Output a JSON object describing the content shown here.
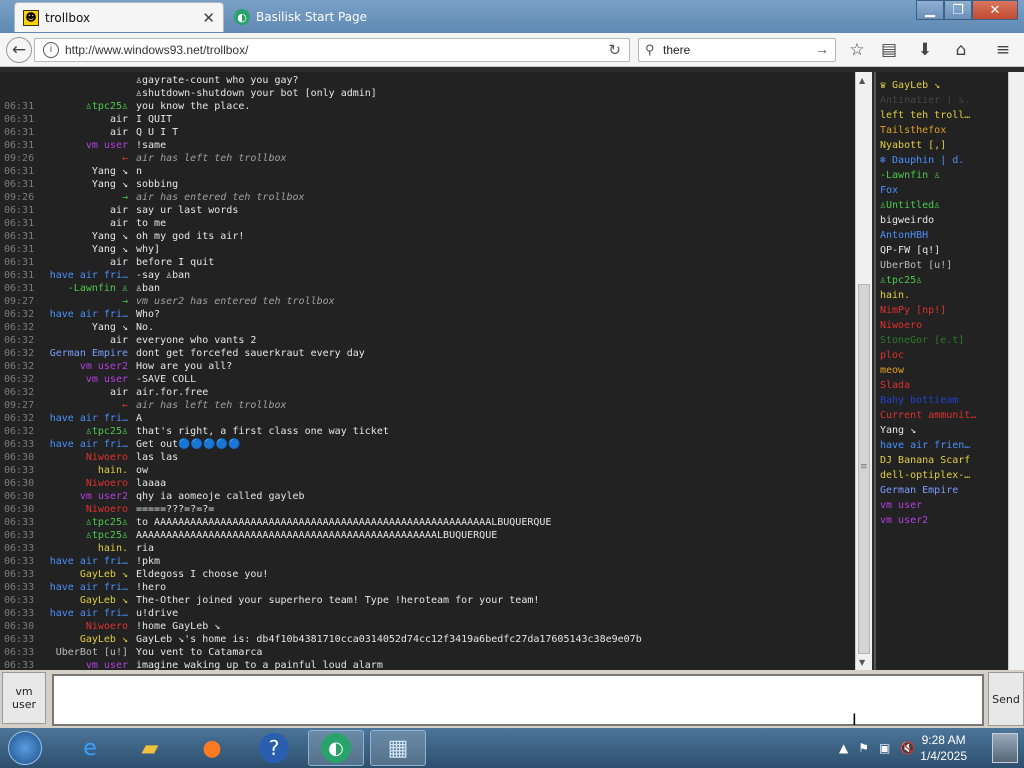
{
  "browser": {
    "tabs": [
      {
        "title": "trollbox",
        "active": true
      },
      {
        "title": "Basilisk Start Page",
        "active": false
      }
    ],
    "url": "http://www.windows93.net/trollbox/",
    "search_value": "there"
  },
  "chat": {
    "messages": [
      {
        "time": "",
        "nick": "",
        "nick_color": "#aaaaaa",
        "text": "♙gayrate-count who you gay?",
        "system": false
      },
      {
        "time": "",
        "nick": "",
        "nick_color": "#aaaaaa",
        "text": "♙shutdown-shutdown your bot [only admin]",
        "system": false
      },
      {
        "time": "06:31",
        "nick": "♙tpc25♙",
        "nick_color": "#4ec94e",
        "text": "you know the place.",
        "system": false
      },
      {
        "time": "06:31",
        "nick": "air",
        "nick_color": "#e6e6e6",
        "text": "I QUIT",
        "system": false
      },
      {
        "time": "06:31",
        "nick": "air",
        "nick_color": "#e6e6e6",
        "text": "Q U I T",
        "system": false
      },
      {
        "time": "06:31",
        "nick": "vm user",
        "nick_color": "#b040e0",
        "text": "!same",
        "system": false
      },
      {
        "time": "09:26",
        "nick": "←",
        "nick_color": "#e03030",
        "text": "air has left teh trollbox",
        "system": true
      },
      {
        "time": "06:31",
        "nick": "Yang ↘",
        "nick_color": "#e6e6e6",
        "text": "n",
        "system": false
      },
      {
        "time": "06:31",
        "nick": "Yang ↘",
        "nick_color": "#e6e6e6",
        "text": " sobbing",
        "system": false
      },
      {
        "time": "09:26",
        "nick": "→",
        "nick_color": "#4ec94e",
        "text": "air has entered teh trollbox",
        "system": true
      },
      {
        "time": "06:31",
        "nick": "air",
        "nick_color": "#e6e6e6",
        "text": "say ur last words",
        "system": false
      },
      {
        "time": "06:31",
        "nick": "air",
        "nick_color": "#e6e6e6",
        "text": "to me",
        "system": false
      },
      {
        "time": "06:31",
        "nick": "Yang ↘",
        "nick_color": "#e6e6e6",
        "text": "oh my god its air!",
        "system": false
      },
      {
        "time": "06:31",
        "nick": "Yang ↘",
        "nick_color": "#e6e6e6",
        "text": "why]",
        "system": false
      },
      {
        "time": "06:31",
        "nick": "air",
        "nick_color": "#e6e6e6",
        "text": "before I quit",
        "system": false
      },
      {
        "time": "06:31",
        "nick": "have air fri…",
        "nick_color": "#4a90ff",
        "text": "-say ♙ban",
        "system": false
      },
      {
        "time": "06:31",
        "nick": "-Lawnfin ♙",
        "nick_color": "#4ec94e",
        "text": "♙ban",
        "system": false
      },
      {
        "time": "09:27",
        "nick": "→",
        "nick_color": "#4ec94e",
        "text": "vm user2 has entered teh trollbox",
        "system": true
      },
      {
        "time": "06:32",
        "nick": "have air fri…",
        "nick_color": "#4a90ff",
        "text": "Who?",
        "system": false
      },
      {
        "time": "06:32",
        "nick": "Yang ↘",
        "nick_color": "#e6e6e6",
        "text": "No.",
        "system": false
      },
      {
        "time": "06:32",
        "nick": "air",
        "nick_color": "#e6e6e6",
        "text": "everyone who vants 2",
        "system": false
      },
      {
        "time": "06:32",
        "nick": "German Empire",
        "nick_color": "#7a9cff",
        "text": "dont get forcefed sauerkraut every day",
        "system": false
      },
      {
        "time": "06:32",
        "nick": "vm user2",
        "nick_color": "#b040e0",
        "text": "How are you all?",
        "system": false
      },
      {
        "time": "06:32",
        "nick": "vm user",
        "nick_color": "#b040e0",
        "text": "-SAVE COLL",
        "system": false
      },
      {
        "time": "06:32",
        "nick": "air",
        "nick_color": "#e6e6e6",
        "text": "air.for.free",
        "system": false
      },
      {
        "time": "09:27",
        "nick": "←",
        "nick_color": "#e03030",
        "text": "air has left teh trollbox",
        "system": true
      },
      {
        "time": "06:32",
        "nick": "have air fri…",
        "nick_color": "#4a90ff",
        "text": "A",
        "system": false
      },
      {
        "time": "06:32",
        "nick": "♙tpc25♙",
        "nick_color": "#4ec94e",
        "text": "that's right, a first class one way ticket",
        "system": false
      },
      {
        "time": "06:33",
        "nick": "have air fri…",
        "nick_color": "#4a90ff",
        "text": "Get out🔵🔵🔵🔵🔵",
        "system": false
      },
      {
        "time": "06:30",
        "nick": "Niwoero",
        "nick_color": "#e03030",
        "text": "las las",
        "system": false
      },
      {
        "time": "06:33",
        "nick": "hain.",
        "nick_color": "#e0d040",
        "text": "ow",
        "system": false
      },
      {
        "time": "06:30",
        "nick": "Niwoero",
        "nick_color": "#e03030",
        "text": "laaaa",
        "system": false
      },
      {
        "time": "06:30",
        "nick": "vm user2",
        "nick_color": "#b040e0",
        "text": "qhy ia aomeoje called gayleb",
        "system": false
      },
      {
        "time": "06:30",
        "nick": "Niwoero",
        "nick_color": "#e03030",
        "text": "=====???=?=?=",
        "system": false
      },
      {
        "time": "06:33",
        "nick": "♙tpc25♙",
        "nick_color": "#4ec94e",
        "text": "to AAAAAAAAAAAAAAAAAAAAAAAAAAAAAAAAAAAAAAAAAAAAAAAAAAAAAAAALBUQUERQUE",
        "system": false
      },
      {
        "time": "06:33",
        "nick": "♙tpc25♙",
        "nick_color": "#4ec94e",
        "text": "AAAAAAAAAAAAAAAAAAAAAAAAAAAAAAAAAAAAAAAAAAAAAAAAAALBUQUERQUE",
        "system": false
      },
      {
        "time": "06:33",
        "nick": "hain.",
        "nick_color": "#e0d040",
        "text": "ria",
        "system": false
      },
      {
        "time": "06:33",
        "nick": "have air fri…",
        "nick_color": "#4a90ff",
        "text": "!pkm",
        "system": false
      },
      {
        "time": "06:33",
        "nick": "GayLeb ↘",
        "nick_color": "#e0d040",
        "text": "Eldegoss I choose you!",
        "system": false
      },
      {
        "time": "06:33",
        "nick": "have air fri…",
        "nick_color": "#4a90ff",
        "text": "!hero",
        "system": false
      },
      {
        "time": "06:33",
        "nick": "GayLeb ↘",
        "nick_color": "#e0d040",
        "text": "The-Other joined your superhero team! Type !heroteam for your team!",
        "system": false
      },
      {
        "time": "06:33",
        "nick": "have air fri…",
        "nick_color": "#4a90ff",
        "text": "u!drive",
        "system": false
      },
      {
        "time": "06:30",
        "nick": "Niwoero",
        "nick_color": "#e03030",
        "text": "!home GayLeb ↘",
        "system": false
      },
      {
        "time": "06:33",
        "nick": "GayLeb ↘",
        "nick_color": "#e0d040",
        "text": "GayLeb ↘'s home is: db4f10b4381710cca0314052d74cc12f3419a6bedfc27da17605143c38e9e07b",
        "system": false
      },
      {
        "time": "06:33",
        "nick": "UberBot [u!]",
        "nick_color": "#bbbbbb",
        "text": "You vent to Catamarca",
        "system": false
      },
      {
        "time": "06:33",
        "nick": "vm user",
        "nick_color": "#b040e0",
        "text": "imagine waking up to a painful loud alarm",
        "system": false
      }
    ]
  },
  "users": [
    {
      "name": "♛ GayLeb ↘",
      "color": "#e0d040"
    },
    {
      "name": "Antinatier | s.",
      "color": "#444444"
    },
    {
      "name": "left teh troll…",
      "color": "#e0d040"
    },
    {
      "name": "Tailsthefox",
      "color": "#e0a020"
    },
    {
      "name": "Nyabott [,]",
      "color": "#e0d040"
    },
    {
      "name": "❄ Dauphin | d.",
      "color": "#4a90ff"
    },
    {
      "name": "-Lawnfin ♙",
      "color": "#4ec94e"
    },
    {
      "name": "Fox",
      "color": "#4a90ff"
    },
    {
      "name": "♙Untitled♙",
      "color": "#4ec94e"
    },
    {
      "name": "bigweirdo",
      "color": "#e6e6e6"
    },
    {
      "name": "AntonHBH",
      "color": "#4a90ff"
    },
    {
      "name": "QP-FW [q!]",
      "color": "#e6e6e6"
    },
    {
      "name": "UberBot [u!]",
      "color": "#bbbbbb"
    },
    {
      "name": "♙tpc25♙",
      "color": "#4ec94e"
    },
    {
      "name": "hain.",
      "color": "#e0d040"
    },
    {
      "name": "NimPy [np!]",
      "color": "#e03030"
    },
    {
      "name": "Niwoero",
      "color": "#e03030"
    },
    {
      "name": "StoneGor [e.t]",
      "color": "#2a7a2a"
    },
    {
      "name": "ploc",
      "color": "#e03030"
    },
    {
      "name": "meow",
      "color": "#e0a020"
    },
    {
      "name": "Slada",
      "color": "#e03030"
    },
    {
      "name": "Bahy bottieam",
      "color": "#2040d0"
    },
    {
      "name": "Current ammunit…",
      "color": "#e03030"
    },
    {
      "name": "Yang ↘",
      "color": "#e6e6e6"
    },
    {
      "name": "have air frien…",
      "color": "#4a90ff"
    },
    {
      "name": "DJ Banana Scarf",
      "color": "#e0d040"
    },
    {
      "name": "dell-optiplex-…",
      "color": "#e0d040"
    },
    {
      "name": "German Empire",
      "color": "#7a9cff"
    },
    {
      "name": "vm user",
      "color": "#b040e0"
    },
    {
      "name": "vm user2",
      "color": "#b040e0"
    }
  ],
  "composer": {
    "current_user_line1": "vm",
    "current_user_line2": "user",
    "input_value": "",
    "send_label": "Send"
  },
  "taskbar": {
    "time": "9:28 AM",
    "date": "1/4/2025"
  }
}
